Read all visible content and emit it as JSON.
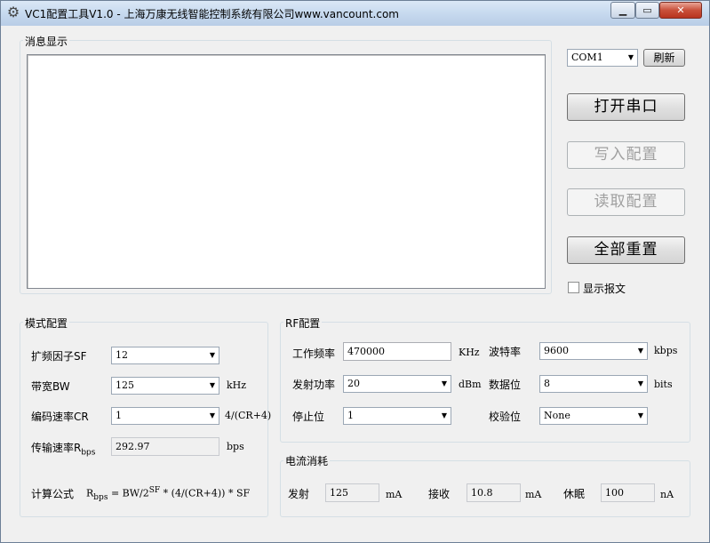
{
  "window": {
    "title": "VC1配置工具V1.0 - 上海万康无线智能控制系统有限公司www.vancount.com",
    "minimize": "▁",
    "maximize": "▭",
    "close": "✕",
    "app_icon": "gear-icon"
  },
  "messages": {
    "group_label": "消息显示"
  },
  "serial": {
    "port_value": "COM1",
    "refresh_label": "刷新",
    "open_label": "打开串口",
    "write_label": "写入配置",
    "read_label": "读取配置",
    "reset_label": "全部重置",
    "show_frames_label": "显示报文",
    "show_frames_checked": false
  },
  "mode": {
    "group_label": "模式配置",
    "sf_label": "扩频因子SF",
    "sf_value": "12",
    "bw_label": "带宽BW",
    "bw_value": "125",
    "bw_unit": "kHz",
    "cr_label": "编码速率CR",
    "cr_value": "1",
    "cr_unit": "4/(CR+4)",
    "rate_label": "传输速率R",
    "rate_sub": "bps",
    "rate_value": "292.97",
    "rate_unit": "bps",
    "formula_label": "计算公式",
    "formula_r": "R",
    "formula_r_sub": "bps",
    "formula_mid": " = BW/2",
    "formula_sup": "SF",
    "formula_tail": " * (4/(CR+4)) * SF"
  },
  "rf": {
    "group_label": "RF配置",
    "freq_label": "工作频率",
    "freq_value": "470000",
    "freq_unit": "KHz",
    "baud_label": "波特率",
    "baud_value": "9600",
    "baud_unit": "kbps",
    "power_label": "发射功率",
    "power_value": "20",
    "power_unit": "dBm",
    "databits_label": "数据位",
    "databits_value": "8",
    "databits_unit": "bits",
    "stopbits_label": "停止位",
    "stopbits_value": "1",
    "parity_label": "校验位",
    "parity_value": "None"
  },
  "current": {
    "group_label": "电流消耗",
    "tx_label": "发射",
    "tx_value": "125",
    "tx_unit": "mA",
    "rx_label": "接收",
    "rx_value": "10.8",
    "rx_unit": "mA",
    "sleep_label": "休眠",
    "sleep_value": "100",
    "sleep_unit": "nA"
  },
  "colors": {
    "titlebar": "#c5d8ee",
    "window_bg": "#f0f0f0",
    "close_button": "#c9503a"
  }
}
